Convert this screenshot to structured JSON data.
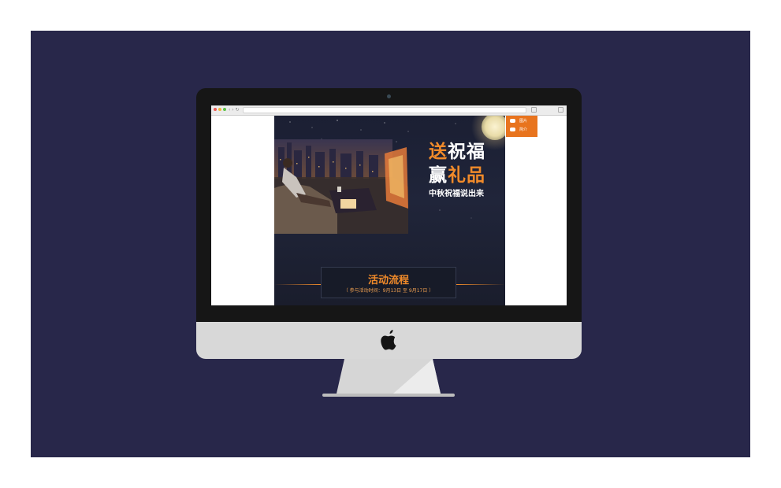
{
  "browser": {
    "nav": "‹ › ↻"
  },
  "campaign": {
    "headline_line1_accent": "送",
    "headline_line1_rest": "祝福",
    "headline_line2_start": "赢",
    "headline_line2_accent": "礼品",
    "subtitle": "中秋祝福说出来",
    "process_title": "活动流程",
    "process_dates": "（ 参与活动时间：9月13日 至 9月17日 ）"
  },
  "side_tab": {
    "items": [
      {
        "label": "图片",
        "icon": "gamepad-icon"
      },
      {
        "label": "简介",
        "icon": "printer-icon"
      }
    ]
  },
  "colors": {
    "background": "#28274a",
    "accent": "#f08a2a",
    "side_tab": "#e8741e",
    "bezel": "#161616",
    "chin": "#d8d8d8"
  },
  "icons": [
    "apple-logo-icon",
    "camera-icon",
    "moon-icon"
  ]
}
